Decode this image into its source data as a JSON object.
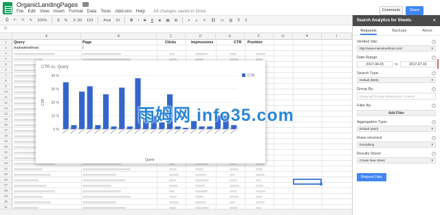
{
  "app": {
    "doc_title": "OrganicLandingPages",
    "menu": [
      "File",
      "Edit",
      "View",
      "Insert",
      "Format",
      "Data",
      "Tools",
      "Add-ons",
      "Help"
    ],
    "save_status": "All changes saved in Drive",
    "comments_label": "Comments",
    "share_label": "Share"
  },
  "toolbar": {
    "zoom": "100%",
    "currency": "$",
    "percent": "%",
    "decimals": ".0 .00",
    "number_format": "123",
    "font": "Arial",
    "font_size": "10",
    "bold": "B",
    "italic": "I",
    "strike": "S",
    "text_color": "A"
  },
  "formula_bar": {
    "fx": "fx"
  },
  "sheet": {
    "columns": [
      "A",
      "B",
      "C",
      "D",
      "E",
      "F",
      "G",
      "H",
      "I"
    ],
    "rows": [
      "1",
      "2",
      "3",
      "4",
      "5",
      "6",
      "7",
      "8",
      "9",
      "10",
      "11",
      "12",
      "13",
      "14",
      "15",
      "16",
      "17",
      "18",
      "19",
      "20",
      "21",
      "22",
      "23",
      "24",
      "25",
      "26",
      "27",
      "28",
      "29",
      "30",
      "31"
    ],
    "headers": {
      "query": "Query",
      "page": "Page",
      "clicks": "Clicks",
      "impressions": "Impressions",
      "ctr": "CTR",
      "position": "Position"
    },
    "row2": {
      "query": "mainstreethost",
      "page": "/"
    }
  },
  "chart_data": {
    "type": "bar",
    "title": "CTR vs. Query",
    "xlabel": "Query",
    "ylabel": "CTR",
    "legend": "top-right",
    "series": [
      {
        "name": "CTR",
        "values": [
          0.35,
          0.03,
          0.28,
          0.32,
          0.03,
          0.26,
          0.02,
          0.31,
          0.02,
          0.38,
          0.08,
          0.1,
          0.05,
          0.26,
          0.02,
          0.01,
          0.06,
          0.02,
          0.02,
          0.1,
          0.1,
          0.03
        ]
      }
    ],
    "yticks": [
      "0 %",
      "10 %",
      "20 %",
      "30 %",
      "40 %"
    ],
    "ylim": [
      0,
      0.4
    ],
    "grid": true,
    "color": "#3366cc"
  },
  "sidebar": {
    "title": "Search Analytics for Sheets",
    "close": "×",
    "tabs": [
      "Requests",
      "Backups",
      "About"
    ],
    "verified_site_label": "Verified Site:",
    "verified_site_value": "http://www.mainstreethost.com/",
    "date_range_label": "Date Range:",
    "date_from": "2017-04-15",
    "date_to_word": "to",
    "date_to": "2017-07-16",
    "search_type_label": "Search Type:",
    "search_type_value": "Default (Web)",
    "group_by_label": "Group By:",
    "group_by_placeholder": "(Optional) Choose Dimensions / Column",
    "filter_by_label": "Filter By:",
    "add_filter": "Add Filter",
    "aggregation_label": "Aggregation Type:",
    "aggregation_value": "Default (auto)",
    "rows_returned_label": "Rows returned:",
    "rows_returned_value": "Everything",
    "results_sheet_label": "Results Sheet:",
    "results_sheet_value": "Create New Sheet",
    "request_data": "Request Data"
  },
  "watermark": "雨姆网 info35.com"
}
